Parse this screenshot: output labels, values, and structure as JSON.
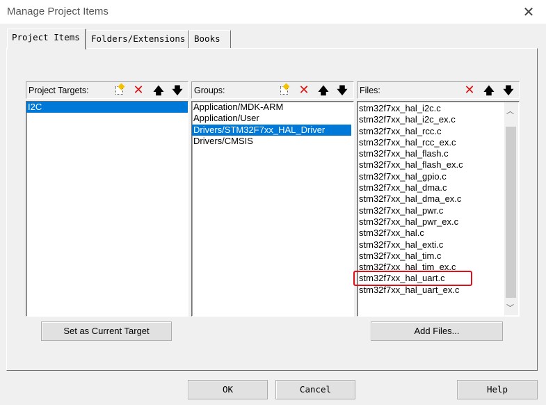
{
  "window": {
    "title": "Manage Project Items",
    "close_glyph": "✕"
  },
  "tabs": [
    {
      "label": "Project Items"
    },
    {
      "label": "Folders/Extensions"
    },
    {
      "label": "Books"
    }
  ],
  "targets_panel": {
    "label": "Project Targets:",
    "items": [
      {
        "label": "I2C",
        "selected": true
      }
    ],
    "set_current_label": "Set as Current Target"
  },
  "groups_panel": {
    "label": "Groups:",
    "items": [
      {
        "label": "Application/MDK-ARM"
      },
      {
        "label": "Application/User"
      },
      {
        "label": "Drivers/STM32F7xx_HAL_Driver",
        "selected": true
      },
      {
        "label": "Drivers/CMSIS"
      }
    ]
  },
  "files_panel": {
    "label": "Files:",
    "items": [
      {
        "label": "stm32f7xx_hal_i2c.c"
      },
      {
        "label": "stm32f7xx_hal_i2c_ex.c"
      },
      {
        "label": "stm32f7xx_hal_rcc.c"
      },
      {
        "label": "stm32f7xx_hal_rcc_ex.c"
      },
      {
        "label": "stm32f7xx_hal_flash.c"
      },
      {
        "label": "stm32f7xx_hal_flash_ex.c"
      },
      {
        "label": "stm32f7xx_hal_gpio.c"
      },
      {
        "label": "stm32f7xx_hal_dma.c"
      },
      {
        "label": "stm32f7xx_hal_dma_ex.c"
      },
      {
        "label": "stm32f7xx_hal_pwr.c"
      },
      {
        "label": "stm32f7xx_hal_pwr_ex.c"
      },
      {
        "label": "stm32f7xx_hal.c"
      },
      {
        "label": "stm32f7xx_hal_exti.c"
      },
      {
        "label": "stm32f7xx_hal_tim.c"
      },
      {
        "label": "stm32f7xx_hal_tim_ex.c"
      },
      {
        "label": "stm32f7xx_hal_uart.c",
        "highlighted": true
      },
      {
        "label": "stm32f7xx_hal_uart_ex.c"
      }
    ],
    "add_files_label": "Add Files...",
    "highlight_color": "#e0101a"
  },
  "icons": {
    "new": "new-item-icon",
    "delete": "delete-icon",
    "up": "move-up-icon",
    "down": "move-down-icon",
    "delete_glyph": "✕",
    "up_glyph": "🡅",
    "down_glyph": "🡇"
  },
  "dialog_buttons": {
    "ok": "OK",
    "cancel": "Cancel",
    "help": "Help"
  },
  "colors": {
    "selection": "#0078d7",
    "delete_icon": "#d81010"
  }
}
